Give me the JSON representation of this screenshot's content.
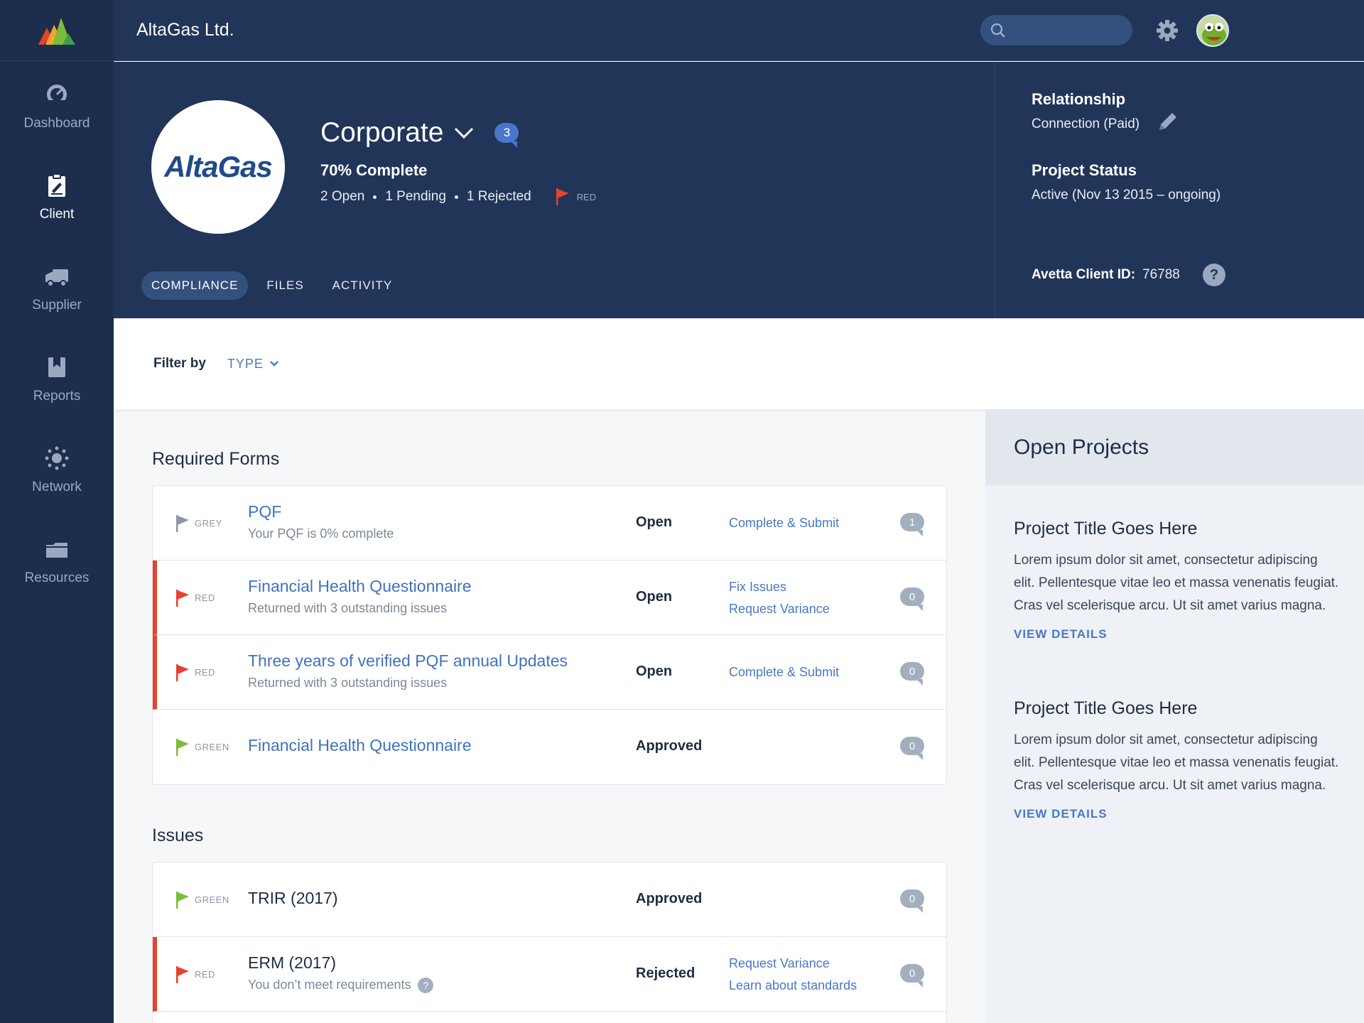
{
  "sidebar": {
    "items": [
      {
        "label": "Dashboard",
        "icon": "gauge-icon"
      },
      {
        "label": "Client",
        "icon": "clipboard-icon"
      },
      {
        "label": "Supplier",
        "icon": "truck-icon"
      },
      {
        "label": "Reports",
        "icon": "bookmark-icon"
      },
      {
        "label": "Network",
        "icon": "network-icon"
      },
      {
        "label": "Resources",
        "icon": "folder-icon"
      }
    ]
  },
  "topbar": {
    "company": "AltaGas Ltd.",
    "search_placeholder": ""
  },
  "header": {
    "logo_text": "AltaGas",
    "title": "Corporate",
    "badge_count": "3",
    "complete": "70% Complete",
    "open": "2 Open",
    "pending": "1 Pending",
    "rejected": "1 Rejected",
    "flag_label": "RED",
    "tabs": [
      "COMPLIANCE",
      "FILES",
      "ACTIVITY"
    ],
    "relationship_label": "Relationship",
    "relationship_value": "Connection (Paid)",
    "project_status_label": "Project Status",
    "project_status_value": "Active (Nov 13 2015 – ongoing)",
    "client_id_label": "Avetta Client ID:",
    "client_id_value": "76788"
  },
  "filter": {
    "label": "Filter by",
    "type": "TYPE"
  },
  "required_forms": {
    "title": "Required Forms",
    "rows": [
      {
        "flag": "GREY",
        "title": "PQF",
        "sub": "Your PQF is 0% complete",
        "status": "Open",
        "actions": [
          "Complete & Submit"
        ],
        "count": "1"
      },
      {
        "flag": "RED",
        "title": "Financial Health Questionnaire",
        "sub": "Returned with 3 outstanding issues",
        "status": "Open",
        "actions": [
          "Fix Issues",
          "Request Variance"
        ],
        "count": "0"
      },
      {
        "flag": "RED",
        "title": "Three years of verified PQF annual Updates",
        "sub": "Returned with 3 outstanding issues",
        "status": "Open",
        "actions": [
          "Complete & Submit"
        ],
        "count": "0"
      },
      {
        "flag": "GREEN",
        "title": "Financial Health Questionnaire",
        "sub": "",
        "status": "Approved",
        "actions": [],
        "count": "0"
      }
    ]
  },
  "issues": {
    "title": "Issues",
    "rows": [
      {
        "flag": "GREEN",
        "title": "TRIR (2017)",
        "sub": "",
        "status": "Approved",
        "actions": [],
        "count": "0"
      },
      {
        "flag": "RED",
        "title": "ERM (2017)",
        "sub": "You don’t meet requirements",
        "status": "Rejected",
        "actions": [
          "Request Variance",
          "Learn about standards"
        ],
        "count": "0"
      }
    ]
  },
  "open_projects": {
    "title": "Open Projects",
    "projects": [
      {
        "title": "Project Title Goes Here",
        "body": "Lorem ipsum dolor sit amet, consectetur adipiscing elit. Pellentesque vitae leo et massa venenatis feugiat. Cras vel scelerisque arcu. Ut sit amet varius magna.",
        "link": "VIEW DETAILS"
      },
      {
        "title": "Project Title Goes Here",
        "body": "Lorem ipsum dolor sit amet, consectetur adipiscing elit. Pellentesque vitae leo et massa venenatis feugiat. Cras vel scelerisque arcu. Ut sit amet varius magna.",
        "link": "VIEW DETAILS"
      }
    ]
  },
  "colors": {
    "sidebar": "#1d2d4c",
    "header": "#213559",
    "accent": "#4878c4",
    "red_flag": "#e4432e",
    "green_flag": "#7dbb3a",
    "grey_flag": "#8d97a8"
  }
}
